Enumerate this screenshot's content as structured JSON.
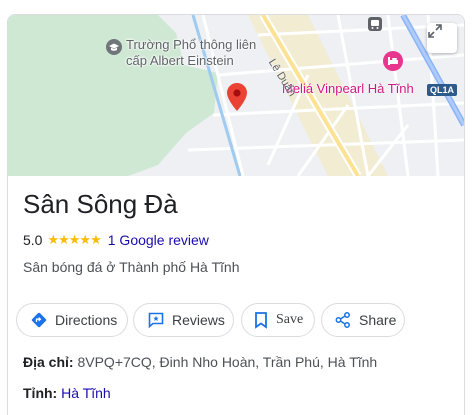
{
  "map": {
    "school_label_line1": "Trường Phổ thông liên",
    "school_label_line2": "cấp Albert Einstein",
    "hotel_label": "Meliá Vinpearl Hà Tĩnh",
    "street_label": "Lê Duẩn",
    "highway_shield": "QL1A",
    "marker_color": "#ea4335"
  },
  "place": {
    "title": "Sân Sông Đà",
    "rating": "5.0",
    "stars": "★★★★★",
    "review_link": "1 Google review",
    "category": "Sân bóng đá ở Thành phố Hà Tĩnh"
  },
  "actions": {
    "directions": "Directions",
    "reviews": "Reviews",
    "save": "Save",
    "share": "Share"
  },
  "info": {
    "address_label": "Địa chỉ:",
    "address_value": "8VPQ+7CQ, Đinh Nho Hoàn, Trần Phú, Hà Tĩnh",
    "province_label": "Tỉnh:",
    "province_value": "Hà Tĩnh"
  },
  "colors": {
    "accent": "#1a73e8",
    "link": "#1a0dab",
    "star": "#fbbc04",
    "hotel": "#d01884"
  }
}
